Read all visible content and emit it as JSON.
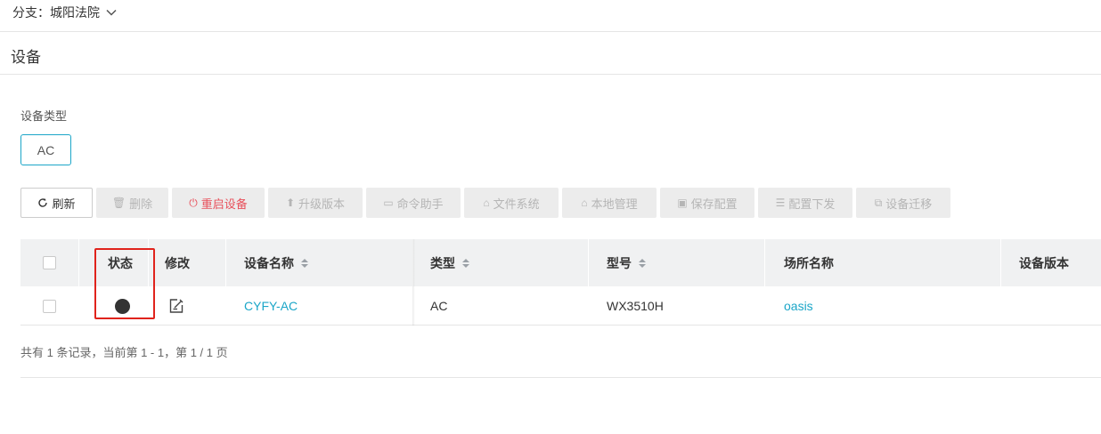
{
  "branch": {
    "prefix": "分支：",
    "name": "城阳法院"
  },
  "page": {
    "title": "设备"
  },
  "filter": {
    "label": "设备类型",
    "chip": "AC"
  },
  "toolbar": {
    "refresh": "刷新",
    "delete": "删除",
    "reboot": "重启设备",
    "upgrade": "升级版本",
    "cmd": "命令助手",
    "fs": "文件系统",
    "local": "本地管理",
    "save": "保存配置",
    "deploy": "配置下发",
    "migrate": "设备迁移"
  },
  "table": {
    "headers": {
      "status": "状态",
      "edit": "修改",
      "name": "设备名称",
      "type": "类型",
      "model": "型号",
      "site": "场所名称",
      "version": "设备版本"
    },
    "rows": [
      {
        "name": "CYFY-AC",
        "type": "AC",
        "model": "WX3510H",
        "site": "oasis",
        "version": ""
      }
    ]
  },
  "pager": {
    "summary": "共有 1 条记录，当前第 1 - 1，第 1 / 1 页"
  },
  "colors": {
    "accent": "#1ba6c8",
    "danger": "#e8505b",
    "highlight": "#e0231c"
  }
}
